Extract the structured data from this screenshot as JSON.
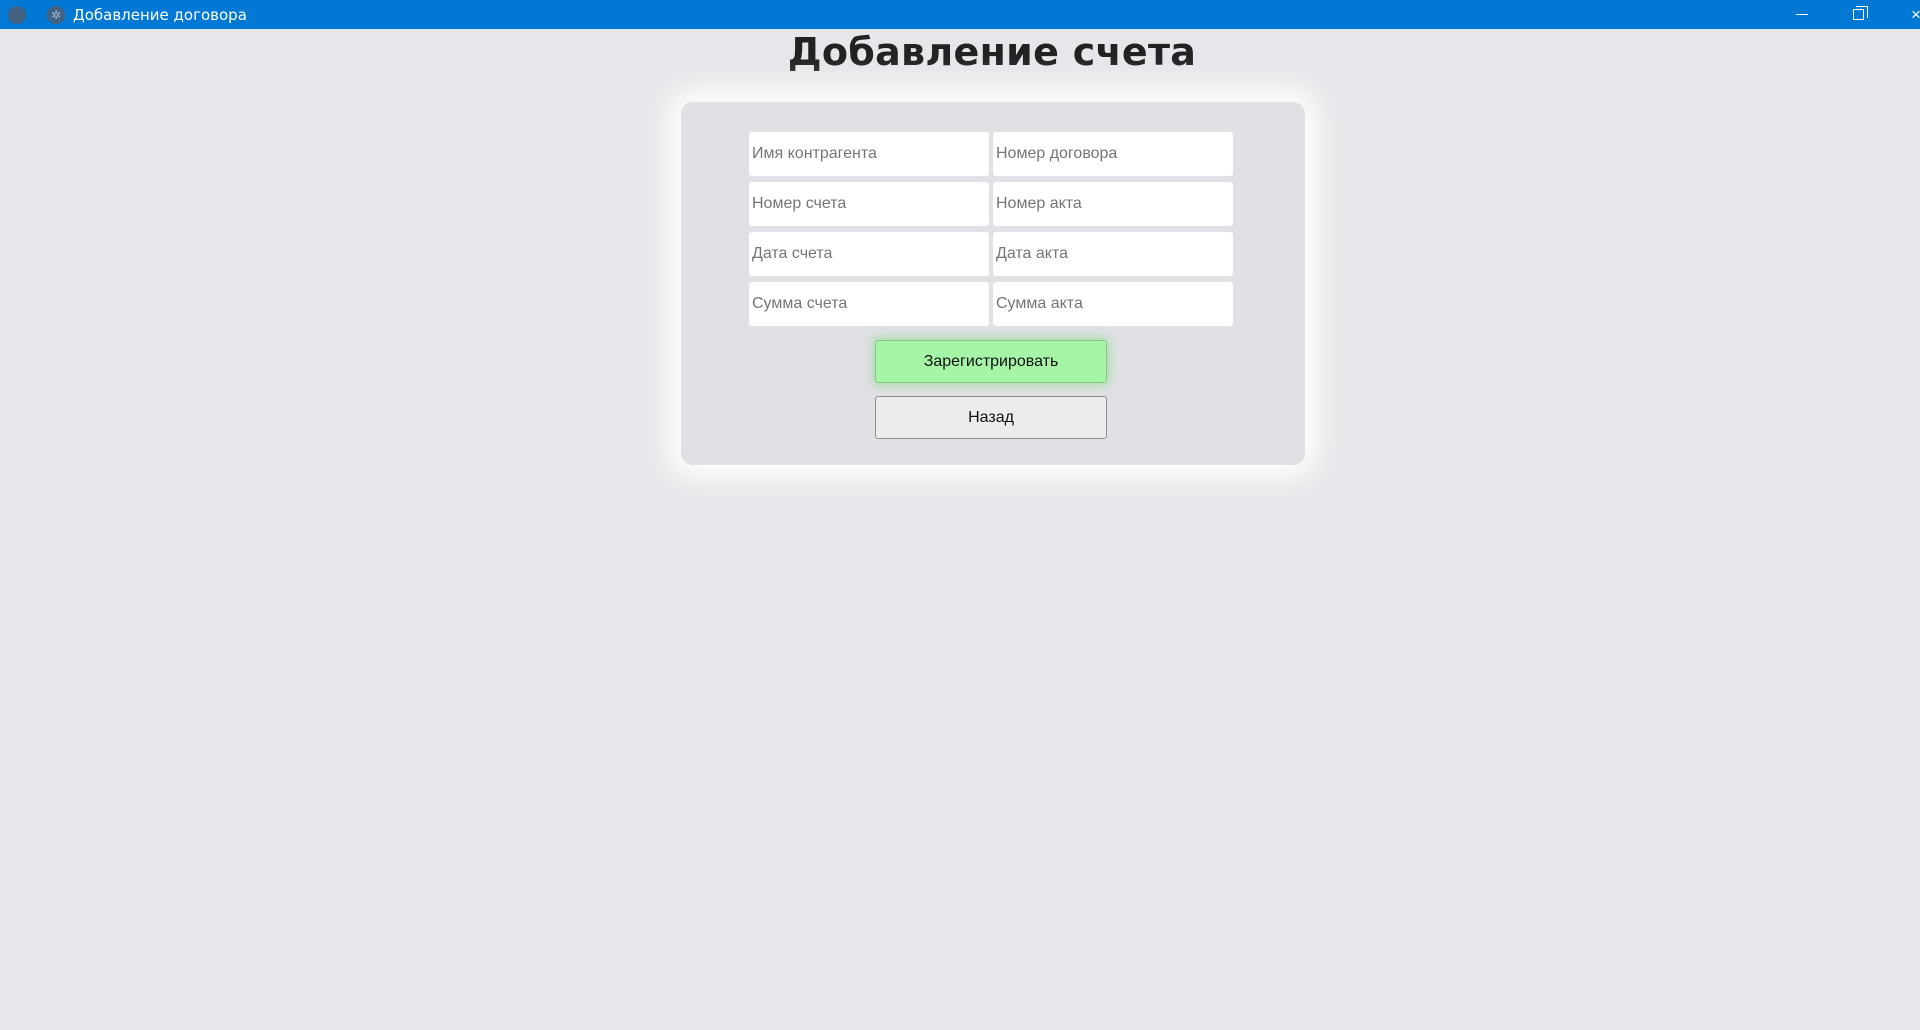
{
  "window": {
    "title": "Добавление договора",
    "app_icon": "app-icon",
    "secondary_icon": "gear-icon",
    "controls": {
      "minimize_icon": "minimize-icon",
      "maximize_icon": "restore-icon",
      "close_icon": "close-icon",
      "close_glyph": "×"
    }
  },
  "colors": {
    "titlebar": "#0078d4",
    "background": "#e7e7eb",
    "register_button": "#a6f5a6"
  },
  "page": {
    "title": "Добавление счета"
  },
  "form": {
    "fields": {
      "contractor_name": {
        "placeholder": "Имя контрагента",
        "value": ""
      },
      "contract_number": {
        "placeholder": "Номер договора",
        "value": ""
      },
      "invoice_number": {
        "placeholder": "Номер счета",
        "value": ""
      },
      "act_number": {
        "placeholder": "Номер акта",
        "value": ""
      },
      "invoice_date": {
        "placeholder": "Дата счета",
        "value": ""
      },
      "act_date": {
        "placeholder": "Дата акта",
        "value": ""
      },
      "invoice_amount": {
        "placeholder": "Сумма счета",
        "value": ""
      },
      "act_amount": {
        "placeholder": "Сумма акта",
        "value": ""
      }
    },
    "register_label": "Зарегистрировать",
    "back_label": "Назад"
  }
}
